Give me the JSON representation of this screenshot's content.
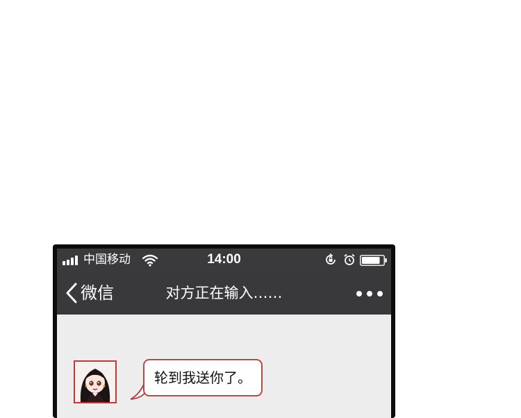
{
  "status_bar": {
    "carrier": "中国移动",
    "time": "14:00",
    "signal_bars": 4,
    "icons": [
      "signal-icon",
      "wifi-icon",
      "rotation-lock-icon",
      "alarm-icon",
      "battery-icon"
    ],
    "battery_level": 0.85
  },
  "nav": {
    "back_label": "微信",
    "title": "对方正在输入……",
    "more_icon": "more-dots-icon"
  },
  "chat": {
    "messages": [
      {
        "text": "轮到我送你了。",
        "side": "left"
      }
    ]
  },
  "colors": {
    "bar_bg": "#39393b",
    "chat_bg": "#ededed",
    "bubble_border": "#b94545",
    "frame": "#0c0c0c"
  }
}
